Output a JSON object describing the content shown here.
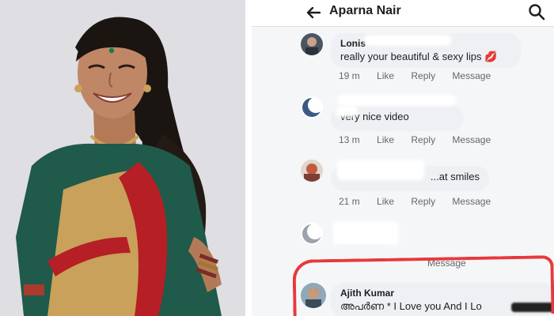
{
  "header": {
    "back_label": "back",
    "title": "Aparna Nair",
    "search_label": "search"
  },
  "comments": [
    {
      "name": "Lonis",
      "text": "really your beautiful & sexy lips 💋",
      "time": "19 m",
      "like": "Like",
      "reply": "Reply",
      "message": "Message"
    },
    {
      "name": "",
      "text": "very nice video",
      "time": "13 m",
      "like": "Like",
      "reply": "Reply",
      "message": "Message"
    },
    {
      "name": "",
      "text": "...at smiles",
      "time": "21 m",
      "like": "Like",
      "reply": "Reply",
      "message": "Message"
    },
    {
      "name": "",
      "text": "",
      "time": "",
      "like": "",
      "reply": "",
      "message": "Message"
    },
    {
      "name": "Ajith Kumar",
      "text": "അപർണ * I Love you And I Lo"
    }
  ],
  "colors": {
    "highlight": "#e8383d",
    "bubble": "#eef0f3",
    "meta_text": "#65676b",
    "saree_green": "#1f5a4a",
    "saree_red": "#b51f25",
    "saree_gold": "#c9a15a"
  },
  "icons": {
    "back": "arrow-left-icon",
    "search": "magnifier-icon"
  }
}
